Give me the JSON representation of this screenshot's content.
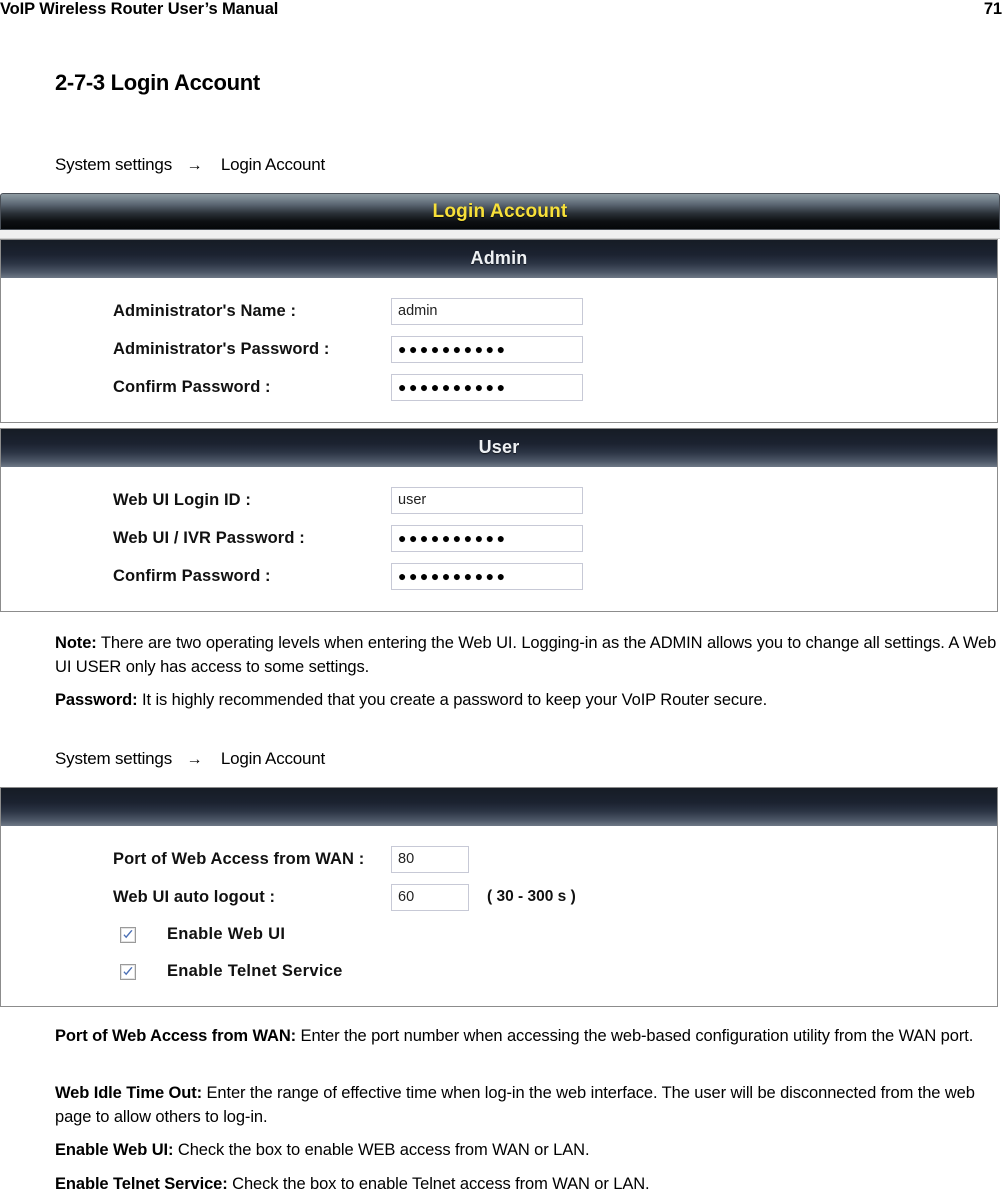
{
  "running_head": {
    "title": "VoIP Wireless Router User’s Manual",
    "page_number": "71"
  },
  "section": {
    "heading": "2-7-3 Login Account"
  },
  "colors": {
    "titlebar_text": "#f7e03a",
    "panel_header_text": "#eef1f4",
    "checkbox_check": "#4a6fb5",
    "page_background": "#ffffff",
    "text": "#000000"
  },
  "breadcrumbs": [
    {
      "root": "System settings",
      "arrow": "→",
      "leaf": "Login Account"
    },
    {
      "root": "System settings",
      "arrow": "→",
      "leaf": "Login Account"
    }
  ],
  "ui_block_1": {
    "titlebar": "Login Account",
    "panels": [
      {
        "header": "Admin",
        "rows": [
          {
            "label": "Administrator's Name :",
            "type": "text",
            "value": "admin",
            "size": "wide"
          },
          {
            "label": "Administrator's Password :",
            "type": "password",
            "value": "●●●●●●●●●●",
            "size": "wide"
          },
          {
            "label": "Confirm Password :",
            "type": "password",
            "value": "●●●●●●●●●●",
            "size": "wide"
          }
        ]
      },
      {
        "header": "User",
        "rows": [
          {
            "label": "Web UI Login ID :",
            "type": "text",
            "value": "user",
            "size": "wide"
          },
          {
            "label": "Web UI / IVR Password :",
            "type": "password",
            "value": "●●●●●●●●●●",
            "size": "wide"
          },
          {
            "label": "Confirm Password :",
            "type": "password",
            "value": "●●●●●●●●●●",
            "size": "wide"
          }
        ]
      }
    ]
  },
  "ui_block_2": {
    "panel": {
      "header": "",
      "rows": [
        {
          "label": "Port of Web Access from WAN :",
          "type": "text",
          "value": "80",
          "size": "small",
          "hint": ""
        },
        {
          "label": "Web UI auto logout :",
          "type": "text",
          "value": "60",
          "size": "small",
          "hint": "( 30 - 300 s )"
        }
      ],
      "checkboxes": [
        {
          "label": "Enable Web UI",
          "checked": true
        },
        {
          "label": "Enable Telnet Service",
          "checked": true
        }
      ]
    }
  },
  "paragraphs": {
    "note": {
      "term": "Note:",
      "body": " There are two operating levels when entering the Web UI. Logging-in as the ADMIN allows you to change all settings. A Web UI USER only has access to some settings."
    },
    "password": {
      "term": "Password:",
      "body": " It is highly recommended that you create a password to keep your VoIP Router secure."
    },
    "port_of_web_access": {
      "term": "Port of Web Access from WAN:",
      "body": " Enter the port number when accessing the web-based configuration utility from the WAN port."
    },
    "web_idle_time_out": {
      "term": "Web Idle Time Out:",
      "body": " Enter the range of effective time when log-in the web interface. The user will be disconnected from the web page to allow others to log-in."
    },
    "enable_web_ui": {
      "term": "Enable Web UI:",
      "body": " Check the box to enable WEB access from WAN or LAN."
    },
    "enable_telnet_service": {
      "term": "Enable Telnet Service:",
      "body": " Check the box to enable Telnet access from WAN or LAN."
    }
  }
}
